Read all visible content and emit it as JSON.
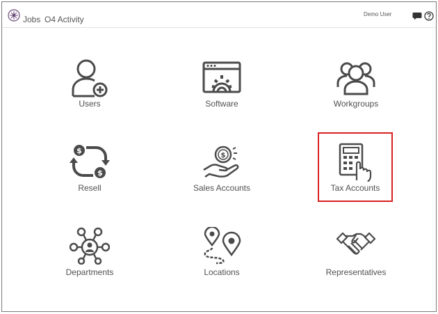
{
  "header": {
    "nav_jobs": "Jobs",
    "nav_activity": "O4 Activity",
    "user_name": "Demo User"
  },
  "tiles": [
    {
      "label": "Users",
      "icon": "user-add-icon"
    },
    {
      "label": "Software",
      "icon": "software-gear-icon"
    },
    {
      "label": "Workgroups",
      "icon": "group-icon"
    },
    {
      "label": "Resell",
      "icon": "resell-cycle-icon"
    },
    {
      "label": "Sales Accounts",
      "icon": "hand-coin-icon"
    },
    {
      "label": "Tax Accounts",
      "icon": "calculator-hand-icon",
      "selected": true
    },
    {
      "label": "Departments",
      "icon": "network-person-icon"
    },
    {
      "label": "Locations",
      "icon": "map-pins-route-icon"
    },
    {
      "label": "Representatives",
      "icon": "handshake-icon"
    }
  ],
  "colors": {
    "icon": "#4a4a4a",
    "selection_border": "#d92020",
    "logo": "#6b4a7a"
  }
}
